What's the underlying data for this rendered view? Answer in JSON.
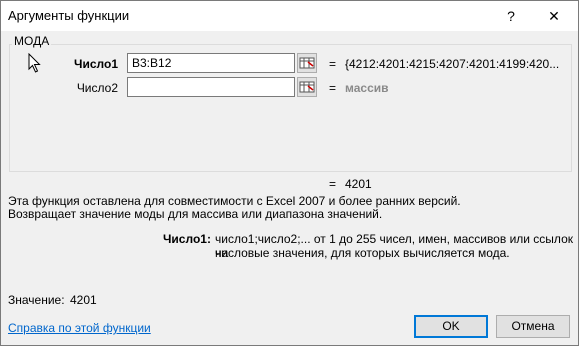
{
  "window": {
    "title": "Аргументы функции",
    "help_glyph": "?",
    "close_glyph": "✕"
  },
  "function_group": {
    "name": "МОДА",
    "args": [
      {
        "label": "Число1",
        "value": "B3:B12",
        "eq": "=",
        "result": "{4212:4201:4215:4207:4201:4199:420..."
      },
      {
        "label": "Число2",
        "value": "",
        "eq": "=",
        "result": "массив"
      }
    ]
  },
  "formula_result": {
    "eq": "=",
    "value": "4201"
  },
  "description": {
    "line1": "Эта функция оставлена для совместимости с Excel 2007 и более ранних версий.",
    "line2": "Возвращает значение моды для массива или диапазона значений."
  },
  "arg_help": {
    "label": "Число1:",
    "line1": "число1;число2;... от 1 до 255 чисел, имен, массивов или ссылок на",
    "line2": "числовые значения, для которых вычисляется мода."
  },
  "value_row": {
    "label": "Значение:",
    "value": "4201"
  },
  "help_link": "Справка по этой функции",
  "buttons": {
    "ok": "OK",
    "cancel": "Отмена"
  }
}
